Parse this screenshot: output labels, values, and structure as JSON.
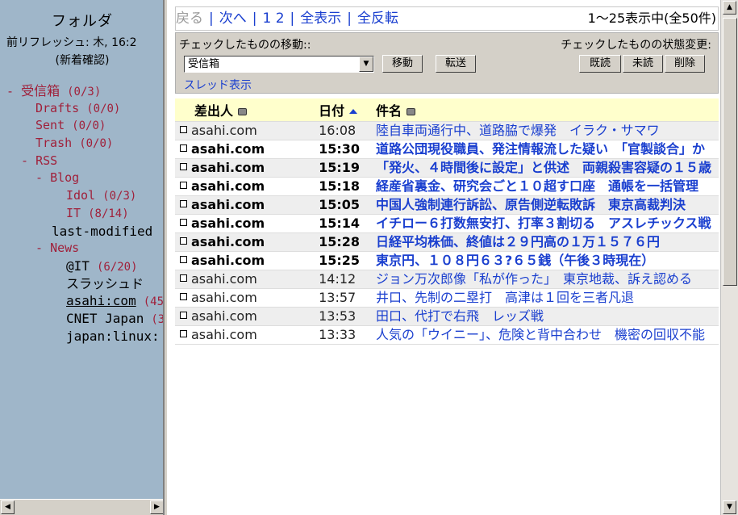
{
  "sidebar": {
    "title": "フォルダ",
    "refresh": "前リフレッシュ: 木, 16:2",
    "check_new": "(新着確認)",
    "inbox": {
      "label": "受信箱",
      "count": "(0/3)"
    },
    "drafts": {
      "label": "Drafts",
      "count": "(0/0)"
    },
    "sent": {
      "label": "Sent",
      "count": "(0/0)"
    },
    "trash": {
      "label": "Trash",
      "count": "(0/0)"
    },
    "rss": {
      "label": "RSS"
    },
    "blog": {
      "label": "Blog"
    },
    "idol": {
      "label": "Idol",
      "count": "(0/3)"
    },
    "it": {
      "label": "IT",
      "count": "(8/14)"
    },
    "last_modified": {
      "label": "last-modified"
    },
    "news": {
      "label": "News"
    },
    "atit": {
      "label": "@IT",
      "count": "(6/20)"
    },
    "slashdot": {
      "label": "スラッシュド"
    },
    "asahi": {
      "label": "asahi:com",
      "count": "(45"
    },
    "cnet": {
      "label": "CNET Japan",
      "count": "(3"
    },
    "japanlinux": {
      "label": "japan:linux:"
    }
  },
  "nav": {
    "back": "戻る",
    "next": "次へ",
    "page1": "1",
    "page2": "2",
    "show_all": "全表示",
    "invert_all": "全反転",
    "status": "1〜25表示中(全50件)"
  },
  "actions": {
    "move_label": "チェックしたものの移動::",
    "state_label": "チェックしたものの状態変更:",
    "folder_select": "受信箱",
    "move_button": "移動",
    "forward_button": "転送",
    "read_button": "既読",
    "unread_button": "未読",
    "delete_button": "削除",
    "thread_view": "スレッド表示"
  },
  "table": {
    "col_from": "差出人",
    "col_date": "日付",
    "col_subject": "件名",
    "rows": [
      {
        "from": "asahi.com",
        "time": "16:08",
        "subject": "陸自車両通行中、道路脇で爆発　イラク・サマワ",
        "unread": false
      },
      {
        "from": "asahi.com",
        "time": "15:30",
        "subject": "道路公団現役職員、発注情報流した疑い　「官製談合」か",
        "unread": true
      },
      {
        "from": "asahi.com",
        "time": "15:19",
        "subject": "「発火、４時間後に設定」と供述　両親殺害容疑の１５歳",
        "unread": true
      },
      {
        "from": "asahi.com",
        "time": "15:18",
        "subject": "経産省裏金、研究会ごと１０超す口座　通帳を一括管理",
        "unread": true
      },
      {
        "from": "asahi.com",
        "time": "15:05",
        "subject": "中国人強制連行訴訟、原告側逆転敗訴　東京高裁判決",
        "unread": true
      },
      {
        "from": "asahi.com",
        "time": "15:14",
        "subject": "イチロー６打数無安打、打率３割切る　アスレチックス戦",
        "unread": true
      },
      {
        "from": "asahi.com",
        "time": "15:28",
        "subject": "日経平均株価、終値は２９円高の１万１５７６円",
        "unread": true
      },
      {
        "from": "asahi.com",
        "time": "15:25",
        "subject": "東京円、１０８円６３?６５銭（午後３時現在）",
        "unread": true
      },
      {
        "from": "asahi.com",
        "time": "14:12",
        "subject": "ジョン万次郎像「私が作った」　東京地裁、訴え認める",
        "unread": false
      },
      {
        "from": "asahi.com",
        "time": "13:57",
        "subject": "井口、先制の二塁打　高津は１回を三者凡退",
        "unread": false
      },
      {
        "from": "asahi.com",
        "time": "13:53",
        "subject": "田口、代打で右飛　レッズ戦",
        "unread": false
      },
      {
        "from": "asahi.com",
        "time": "13:33",
        "subject": "人気の「ウイニー」、危険と背中合わせ　機密の回収不能",
        "unread": false
      }
    ]
  }
}
